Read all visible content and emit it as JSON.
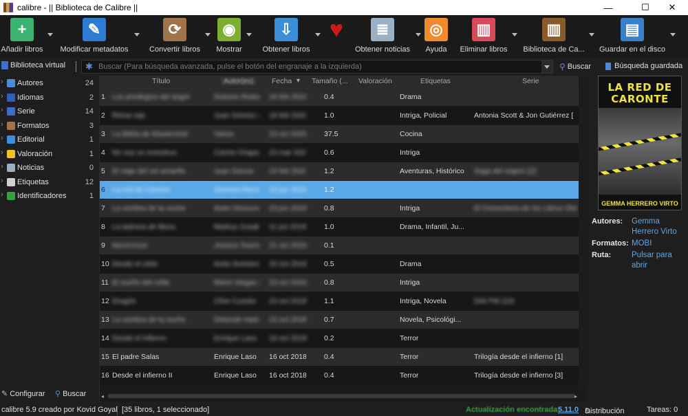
{
  "window": {
    "title": "calibre - || Biblioteca de Calibre ||",
    "minimize": "—",
    "maximize": "☐",
    "close": "✕"
  },
  "toolbar": [
    {
      "label": "Añadir libros",
      "icon": "add-book-icon",
      "color": "#3cb371",
      "glyph": "+"
    },
    {
      "label": "Modificar metadatos",
      "icon": "edit-metadata-icon",
      "color": "#2e7bd6",
      "glyph": "✎"
    },
    {
      "label": "Convertir libros",
      "icon": "convert-books-icon",
      "color": "#a0744a",
      "glyph": "⟳"
    },
    {
      "label": "Mostrar",
      "icon": "view-icon",
      "color": "#7cae32",
      "glyph": "◉"
    },
    {
      "label": "Obtener libros",
      "icon": "get-books-icon",
      "color": "#3a8fd8",
      "glyph": "⇩"
    },
    {
      "label": "",
      "icon": "donate-heart-icon",
      "color": "#d01818",
      "glyph": "♥"
    },
    {
      "label": "Obtener noticias",
      "icon": "news-icon",
      "color": "#9ab0c4",
      "glyph": "≣"
    },
    {
      "label": "Ayuda",
      "icon": "help-lifebuoy-icon",
      "color": "#f08a2a",
      "glyph": "◎"
    },
    {
      "label": "Eliminar libros",
      "icon": "delete-books-icon",
      "color": "#d84a58",
      "glyph": "▥"
    },
    {
      "label": "Biblioteca de Ca...",
      "icon": "library-icon",
      "color": "#8a5a2a",
      "glyph": "▥"
    },
    {
      "label": "Guardar en el disco",
      "icon": "save-disk-icon",
      "color": "#3a80c8",
      "glyph": "▤"
    }
  ],
  "search": {
    "virtual_library": "Biblioteca virtual",
    "placeholder": "Buscar (Para búsqueda avanzada, pulse el botón del engranaje a la izquierda)",
    "search_button": "Buscar",
    "saved_search_button": "Búsqueda guardada"
  },
  "tag_browser": {
    "items": [
      {
        "label": "Autores",
        "count": "24",
        "icon": "authors-icon",
        "color": "#4a8ad8"
      },
      {
        "label": "Idiomas",
        "count": "2",
        "icon": "languages-icon",
        "color": "#2e5fb8"
      },
      {
        "label": "Serie",
        "count": "14",
        "icon": "series-icon",
        "color": "#3a6fc8"
      },
      {
        "label": "Formatos",
        "count": "3",
        "icon": "formats-icon",
        "color": "#a0744a"
      },
      {
        "label": "Editorial",
        "count": "1",
        "icon": "publisher-icon",
        "color": "#3a8fd8"
      },
      {
        "label": "Valoración",
        "count": "1",
        "icon": "rating-star-icon",
        "color": "#f0c020"
      },
      {
        "label": "Noticias",
        "count": "0",
        "icon": "news-icon",
        "color": "#9ab0c4"
      },
      {
        "label": "Etiquetas",
        "count": "12",
        "icon": "tags-icon",
        "color": "#d0d0d0"
      },
      {
        "label": "Identificadores",
        "count": "1",
        "icon": "identifiers-icon",
        "color": "#3aa040"
      }
    ],
    "configure": "Configurar",
    "find": "Buscar"
  },
  "table": {
    "columns": [
      "Título",
      "Autor(es)",
      "Fecha",
      "Tamaño (...",
      "Valoración",
      "Etiquetas",
      "Serie"
    ],
    "rows": [
      {
        "n": "1",
        "title": "Los privilegios del ángel",
        "author": "Dolores Redondo",
        "date": "16 feb 2018",
        "size": "0.4",
        "tags": "Drama",
        "series": ""
      },
      {
        "n": "2",
        "title": "Reina roja",
        "author": "Juan Gómez-Jurado",
        "date": "16 feb 2020",
        "size": "1.0",
        "tags": "Intriga, Policial",
        "series": "Antonia Scott & Jon Gutiérrez ["
      },
      {
        "n": "3",
        "title": "La Biblia de Masterchef",
        "author": "Varios",
        "date": "23 oct 2020",
        "size": "37.5",
        "tags": "Cocina",
        "series": ""
      },
      {
        "n": "4",
        "title": "No soy un monstruo",
        "author": "Carme Chaparro",
        "date": "23 mar 2020",
        "size": "0.6",
        "tags": "Intriga",
        "series": ""
      },
      {
        "n": "5",
        "title": "El viaje del sol amarillo",
        "author": "Juan García",
        "date": "23 feb 2020",
        "size": "1.2",
        "tags": "Aventuras, Histórico",
        "series": "Saga del viajero [2]"
      },
      {
        "n": "6",
        "title": "La red de Caronte",
        "author": "Gemma Herrero Virto",
        "date": "15 jun 2019",
        "size": "1.2",
        "tags": "",
        "series": ""
      },
      {
        "n": "7",
        "title": "La sombra de la noche",
        "author": "Autor Desconocido",
        "date": "23 jun 2019",
        "size": "0.8",
        "tags": "Intriga",
        "series": "El Cementerio de los Libros Olvidados (2)"
      },
      {
        "n": "8",
        "title": "La ladrona de libros",
        "author": "Markus Zusak",
        "date": "11 jun 2019",
        "size": "1.0",
        "tags": "Drama, Infantil, Ju...",
        "series": ""
      },
      {
        "n": "9",
        "title": "Nevermoor",
        "author": "Jessica Townsend",
        "date": "21 oct 2019",
        "size": "0.1",
        "tags": "",
        "series": ""
      },
      {
        "n": "10",
        "title": "Desde el cielo",
        "author": "Autor Anónimo",
        "date": "23 oct 2019",
        "size": "0.5",
        "tags": "Drama",
        "series": ""
      },
      {
        "n": "11",
        "title": "El sueño del celta",
        "author": "Mario Vargas Llosa",
        "date": "23 oct 2018",
        "size": "0.8",
        "tags": "Intriga",
        "series": ""
      },
      {
        "n": "12",
        "title": "Dragón",
        "author": "Clive Cussler",
        "date": "23 oct 2018",
        "size": "1.1",
        "tags": "Intriga, Novela",
        "series": "Dirk Pitt (10)"
      },
      {
        "n": "13",
        "title": "La sombra de la noche",
        "author": "Deborah Harkness",
        "date": "23 oct 2018",
        "size": "0.7",
        "tags": "Novela, Psicológi...",
        "series": ""
      },
      {
        "n": "14",
        "title": "Desde el infierno",
        "author": "Enrique Laso",
        "date": "16 oct 2018",
        "size": "0.2",
        "tags": "Terror",
        "series": ""
      },
      {
        "n": "15",
        "title": "El padre Salas",
        "author": "Enrique Laso",
        "date": "16 oct 2018",
        "size": "0.4",
        "tags": "Terror",
        "series": "Trilogía desde el infierno [1]"
      },
      {
        "n": "16",
        "title": "Desde el infierno II",
        "author": "Enrique Laso",
        "date": "16 oct 2018",
        "size": "0.4",
        "tags": "Terror",
        "series": "Trilogía desde el infierno [3]"
      }
    ],
    "blurred_rows": [
      "1",
      "2",
      "3",
      "4",
      "5",
      "6",
      "7",
      "8",
      "9",
      "10",
      "11",
      "12",
      "13",
      "14"
    ],
    "selected_row": "6"
  },
  "book_details": {
    "cover_title": "LA RED DE CARONTE",
    "cover_author": "GEMMA HERRERO VIRTO",
    "authors_label": "Autores:",
    "authors_value": "Gemma Herrero Virto",
    "formats_label": "Formatos:",
    "formats_value": "MOBI",
    "path_label": "Ruta:",
    "path_value": "Pulsar para abrir"
  },
  "statusbar": {
    "left": "calibre 5.9 creado por Kovid Goyal",
    "counts": "[35 libros, 1 seleccionado]",
    "update_label": "Actualización encontrada:",
    "update_version": "5.11.0",
    "layout": "Distribución",
    "jobs": "Tareas: 0"
  },
  "colors": {
    "accent": "#5ba8e8",
    "update_green": "#3aa040"
  }
}
